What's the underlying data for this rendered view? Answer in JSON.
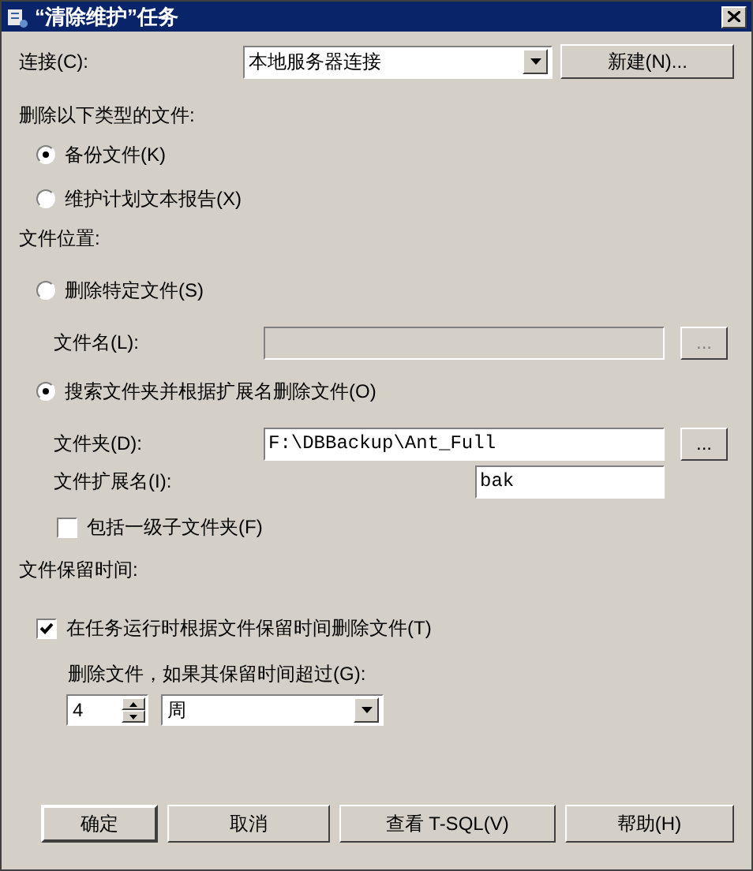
{
  "window": {
    "title": "“清除维护”任务"
  },
  "connection": {
    "label": "连接(C):",
    "value": "本地服务器连接",
    "new_button": "新建(N)..."
  },
  "file_types": {
    "label": "删除以下类型的文件:",
    "options": [
      {
        "label": "备份文件(K)",
        "selected": true
      },
      {
        "label": "维护计划文本报告(X)",
        "selected": false
      }
    ]
  },
  "file_location": {
    "label": "文件位置:",
    "specific_file": {
      "label": "删除特定文件(S)",
      "selected": false,
      "file_name_label": "文件名(L):",
      "browse_button": "...",
      "disabled": true
    },
    "search_folder": {
      "label": "搜索文件夹并根据扩展名删除文件(O)",
      "selected": true,
      "folder_label": "文件夹(D):",
      "folder_value": "F:\\DBBackup\\Ant_Full",
      "browse_button": "...",
      "extension_label": "文件扩展名(I):",
      "extension_value": "bak",
      "include_subfolders": {
        "label": "包括一级子文件夹(F)",
        "checked": false
      }
    }
  },
  "retention": {
    "label": "文件保留时间:",
    "delete_by_age": {
      "label": "在任务运行时根据文件保留时间删除文件(T)",
      "checked": true
    },
    "age_label": "删除文件，如果其保留时间超过(G):",
    "age_value": "4",
    "unit": "周"
  },
  "buttons": [
    "确定",
    "取消",
    "查看 T-SQL(V)",
    "帮助(H)"
  ]
}
